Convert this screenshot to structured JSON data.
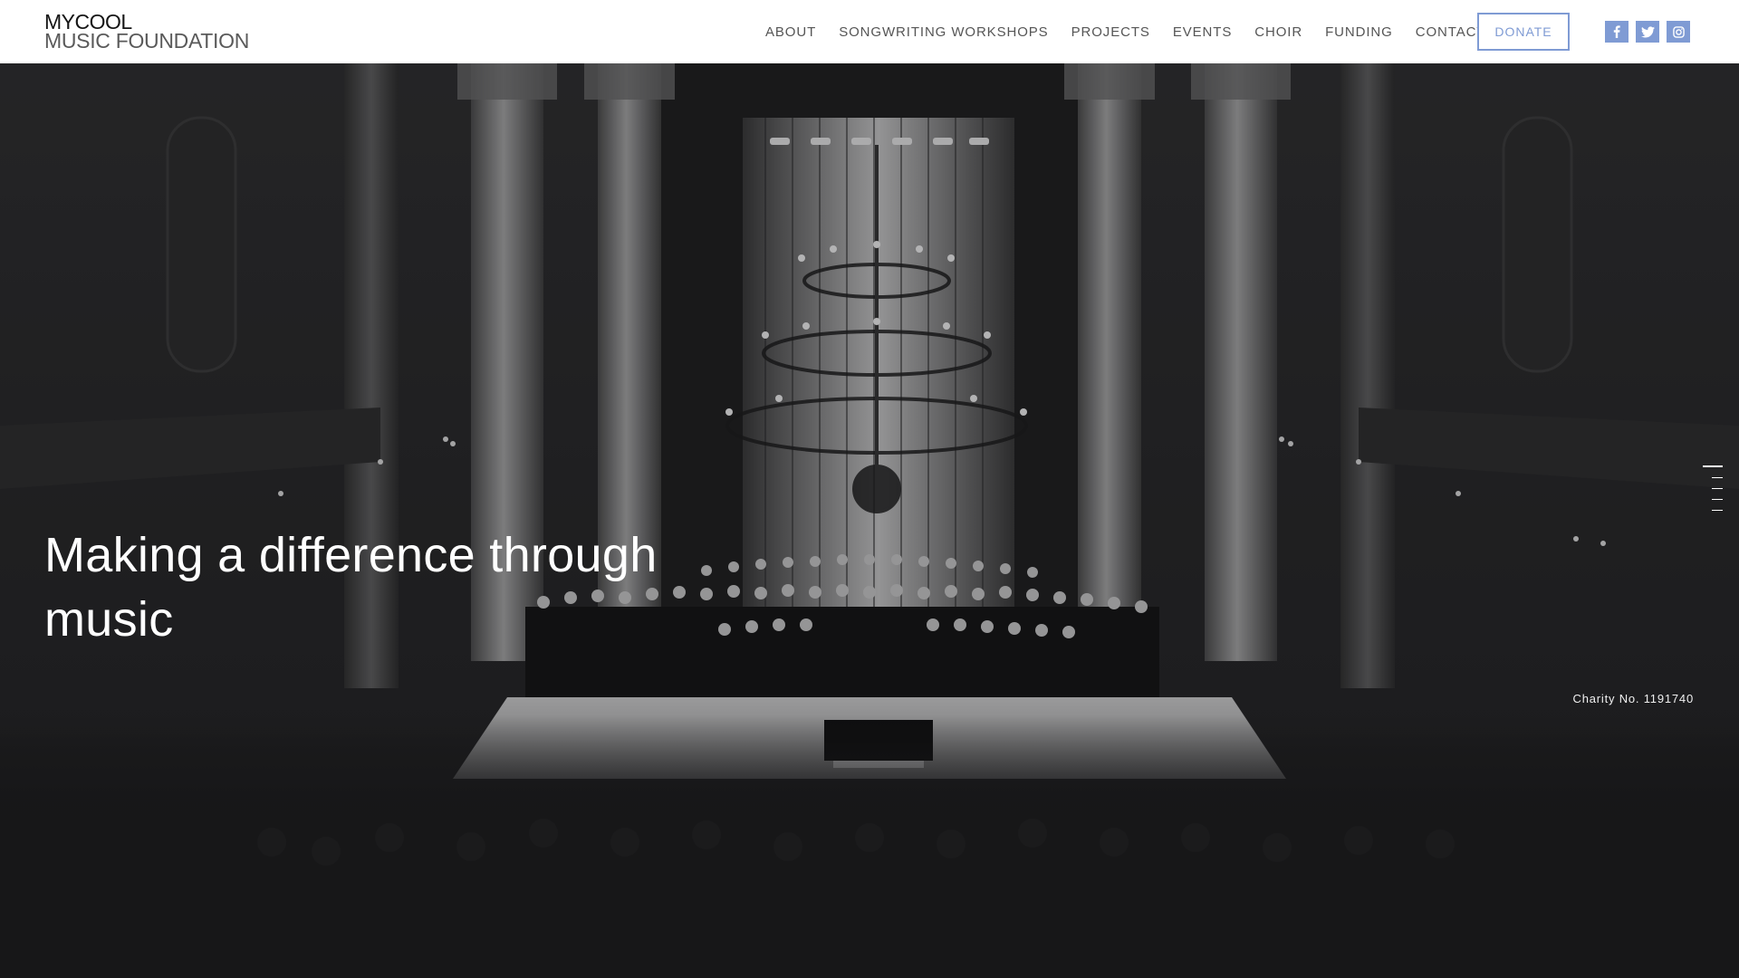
{
  "header": {
    "logo_line1": "MYCOOL",
    "logo_line2": "MUSIC FOUNDATION",
    "nav": [
      {
        "label": "ABOUT"
      },
      {
        "label": "SONGWRITING WORKSHOPS"
      },
      {
        "label": "PROJECTS"
      },
      {
        "label": "EVENTS"
      },
      {
        "label": "CHOIR"
      },
      {
        "label": "FUNDING"
      },
      {
        "label": "CONTACT"
      }
    ],
    "donate_label": "DONATE",
    "social_icons": [
      "facebook-icon",
      "twitter-icon",
      "instagram-icon"
    ],
    "accent_color": "#7f9bd4"
  },
  "hero": {
    "title": "Making a difference through music",
    "charity": "Charity No. 1191740",
    "image": "choir performing on stage in a church hall",
    "slide_count": 5,
    "active_slide": 1
  }
}
